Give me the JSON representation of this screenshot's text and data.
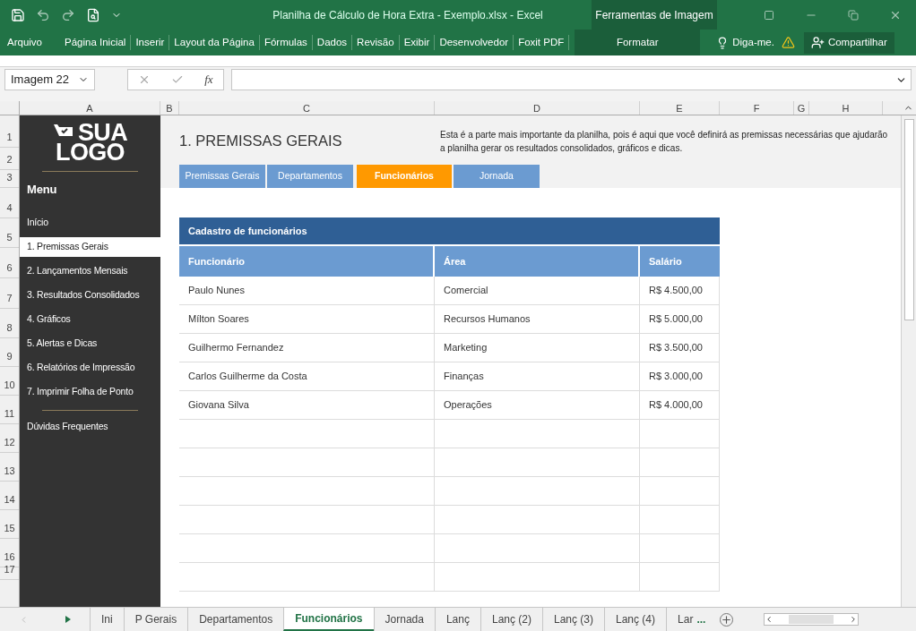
{
  "window": {
    "title": "Planilha de Cálculo de Hora Extra - Exemplo.xlsx - Excel",
    "context_group": "Ferramentas de Imagem"
  },
  "ribbon_tabs": [
    {
      "label": "Arquivo",
      "kind": "file"
    },
    {
      "label": "Página Inicial",
      "kind": "tab"
    },
    {
      "label": "Inserir",
      "kind": "tab"
    },
    {
      "label": "Layout da Página",
      "kind": "tab"
    },
    {
      "label": "Fórmulas",
      "kind": "tab"
    },
    {
      "label": "Dados",
      "kind": "tab"
    },
    {
      "label": "Revisão",
      "kind": "tab"
    },
    {
      "label": "Exibir",
      "kind": "tab"
    },
    {
      "label": "Desenvolvedor",
      "kind": "tab"
    },
    {
      "label": "Foxit PDF",
      "kind": "tab"
    },
    {
      "label": "Formatar",
      "kind": "context"
    }
  ],
  "tell_me": "Diga-me.",
  "share": "Compartilhar",
  "formula_bar": {
    "name_box": "Imagem 22",
    "fx": "fx"
  },
  "columns": [
    "A",
    "B",
    "C",
    "D",
    "E",
    "F",
    "G",
    "H"
  ],
  "rows": [
    "1",
    "2",
    "3",
    "4",
    "5",
    "6",
    "7",
    "8",
    "9",
    "10",
    "11",
    "12",
    "13",
    "14",
    "15",
    "16",
    "17"
  ],
  "sidebar": {
    "logo": [
      "SUA",
      "LOGO"
    ],
    "title": "Menu",
    "items": [
      {
        "label": "Início",
        "selected": false
      },
      {
        "label": "1. Premissas Gerais",
        "selected": true
      },
      {
        "label": "2. Lançamentos Mensais",
        "selected": false
      },
      {
        "label": "3. Resultados Consolidados",
        "selected": false
      },
      {
        "label": "4. Gráficos",
        "selected": false
      },
      {
        "label": "5. Alertas e Dicas",
        "selected": false
      },
      {
        "label": "6. Relatórios de Impressão",
        "selected": false
      },
      {
        "label": "7. Imprimir Folha de Ponto",
        "selected": false
      }
    ],
    "footer": "Dúvidas Frequentes"
  },
  "page": {
    "title": "1. PREMISSAS GERAIS",
    "description": "Esta é a parte mais importante da planilha, pois é aqui que você definirá as premissas necessárias que ajudarão a planilha gerar os resultados consolidados, gráficos e dicas.",
    "tabs": [
      {
        "label": "Premissas Gerais",
        "selected": false
      },
      {
        "label": "Departamentos",
        "selected": false
      },
      {
        "label": "Funcionários",
        "selected": true
      },
      {
        "label": "Jornada",
        "selected": false
      }
    ]
  },
  "table": {
    "title": "Cadastro de funcionários",
    "columns": [
      "Funcionário",
      "Área",
      "Salário"
    ],
    "rows": [
      [
        "Paulo Nunes",
        "Comercial",
        "R$ 4.500,00"
      ],
      [
        "Mílton Soares",
        "Recursos Humanos",
        "R$ 5.000,00"
      ],
      [
        "Guilhermo Fernandez",
        "Marketing",
        "R$ 3.500,00"
      ],
      [
        "Carlos Guilherme da Costa",
        "Finanças",
        "R$ 3.000,00"
      ],
      [
        "Giovana Silva",
        "Operações",
        "R$ 4.000,00"
      ]
    ]
  },
  "sheet_tabs": [
    {
      "label": "Ini",
      "selected": false
    },
    {
      "label": "P Gerais",
      "selected": false
    },
    {
      "label": "Departamentos",
      "selected": false
    },
    {
      "label": "Funcionários",
      "selected": true
    },
    {
      "label": "Jornada",
      "selected": false
    },
    {
      "label": "Lanç",
      "selected": false
    },
    {
      "label": "Lanç (2)",
      "selected": false
    },
    {
      "label": "Lanç (3)",
      "selected": false
    },
    {
      "label": "Lanç (4)",
      "selected": false
    },
    {
      "label": "Lar",
      "selected": false
    }
  ],
  "more_tabs": "..."
}
